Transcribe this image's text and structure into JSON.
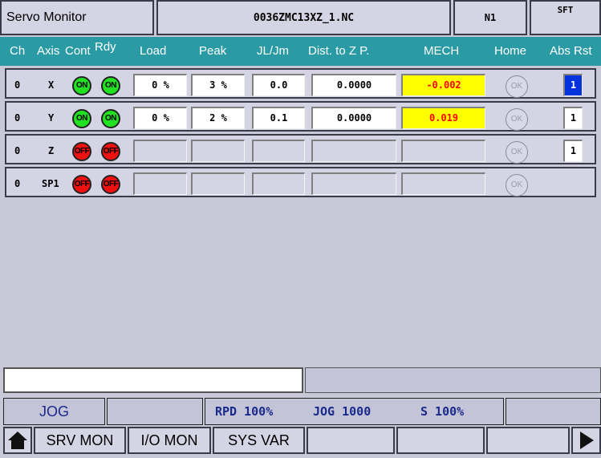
{
  "header": {
    "title": "Servo Monitor",
    "file": "0036ZMC13XZ_1.NC",
    "seq": "N1",
    "mode_flag": "SFT"
  },
  "columns": {
    "ch": "Ch",
    "axis": "Axis",
    "cont": "Cont",
    "rdy": "Rdy",
    "load": "Load",
    "peak": "Peak",
    "jl_jm": "JL/Jm",
    "dist": "Dist. to Z P.",
    "mech": "MECH",
    "home": "Home",
    "abs_rst": "Abs Rst"
  },
  "rows": [
    {
      "ch": "0",
      "axis": "X",
      "cont": "ON",
      "rdy": "ON",
      "load": "0 %",
      "peak": "3 %",
      "jl_jm": "0.0",
      "dist": "0.0000",
      "mech": "-0.002",
      "home": "OK",
      "abs_rst": "1"
    },
    {
      "ch": "0",
      "axis": "Y",
      "cont": "ON",
      "rdy": "ON",
      "load": "0 %",
      "peak": "2 %",
      "jl_jm": "0.1",
      "dist": "0.0000",
      "mech": "0.019",
      "home": "OK",
      "abs_rst": "1"
    },
    {
      "ch": "0",
      "axis": "Z",
      "cont": "OFF",
      "rdy": "OFF",
      "home": "OK",
      "abs_rst": "1"
    },
    {
      "ch": "0",
      "axis": "SP1",
      "cont": "OFF",
      "rdy": "OFF",
      "home": "OK"
    }
  ],
  "input": {
    "value": ""
  },
  "status": {
    "mode": "JOG",
    "rapid": "RPD 100%",
    "jog": "JOG 1000",
    "spindle": "S 100%"
  },
  "softkeys": {
    "srv_mon": "SRV MON",
    "io_mon": "I/O MON",
    "sys_var": "SYS VAR"
  },
  "icons": {
    "home": "home-icon",
    "next": "next-page-icon"
  },
  "colors": {
    "header_bar": "#2a9aa5",
    "on": "#22e022",
    "off": "#ee1111",
    "mech_highlight": "#ffff00",
    "mech_text": "#ff0000",
    "abs_selected": "#0033dd"
  }
}
